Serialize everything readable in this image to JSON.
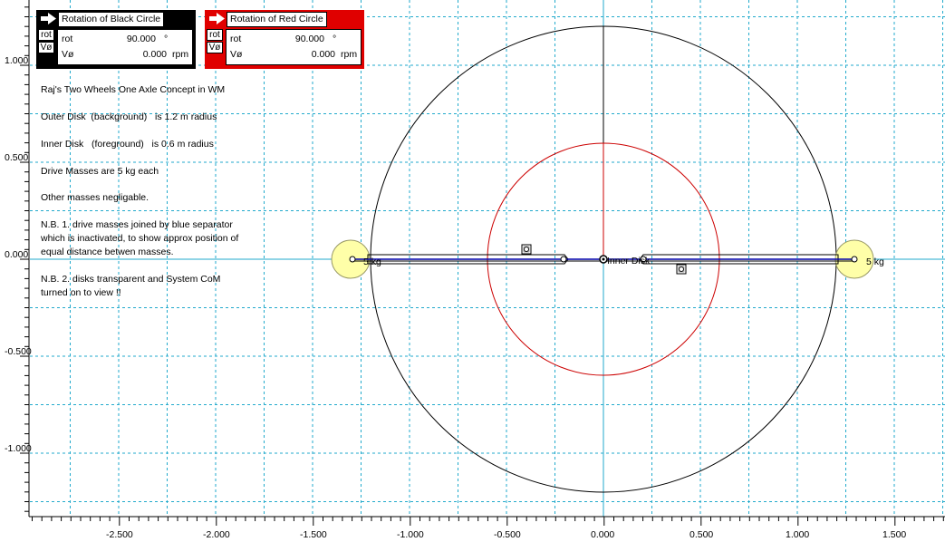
{
  "meters": [
    {
      "id": "black",
      "title": "Rotation of Black Circle",
      "color": "#000000",
      "buttons": [
        "rot",
        "Vø"
      ],
      "rows": [
        {
          "label": "rot",
          "value": "90.000",
          "unit": "°"
        },
        {
          "label": "Vø",
          "value": "0.000",
          "unit": "rpm"
        }
      ]
    },
    {
      "id": "red",
      "title": "Rotation of Red Circle",
      "color": "#e00000",
      "buttons": [
        "rot",
        "Vø"
      ],
      "rows": [
        {
          "label": "rot",
          "value": "90.000",
          "unit": "°"
        },
        {
          "label": "Vø",
          "value": "0.000",
          "unit": "rpm"
        }
      ]
    }
  ],
  "notes": [
    "Raj's Two Wheels One Axle Concept in WM",
    "Outer Disk  (background)   is 1.2 m radius",
    "Inner Disk   (foreground)   is 0.6 m radius",
    "Drive Masses are 5 kg each",
    "Other masses negligable.",
    "N.B. 1. drive masses joined by blue separator\nwhich is inactivated, to show approx position of\nequal distance betwen masses.",
    "N.B. 2. disks transparent and System CoM\nturned on to view !!"
  ],
  "labels": {
    "left_mass": "5 kg",
    "right_mass": "5 kg",
    "inner_disk": "Inner Disk"
  },
  "axes": {
    "x_ticks": [
      "-2.500",
      "-2.000",
      "-1.500",
      "-1.000",
      "-0.500",
      "0.000",
      "0.500",
      "1.000",
      "1.500"
    ],
    "y_ticks": [
      "1.000",
      "0.500",
      "0.000",
      "-0.500",
      "-1.000"
    ]
  },
  "colors": {
    "outer_disk": "#000000",
    "inner_disk": "#cc0000",
    "grid": "#22aacc",
    "separator": "#0000aa",
    "mass_fill": "#ffffa8"
  }
}
